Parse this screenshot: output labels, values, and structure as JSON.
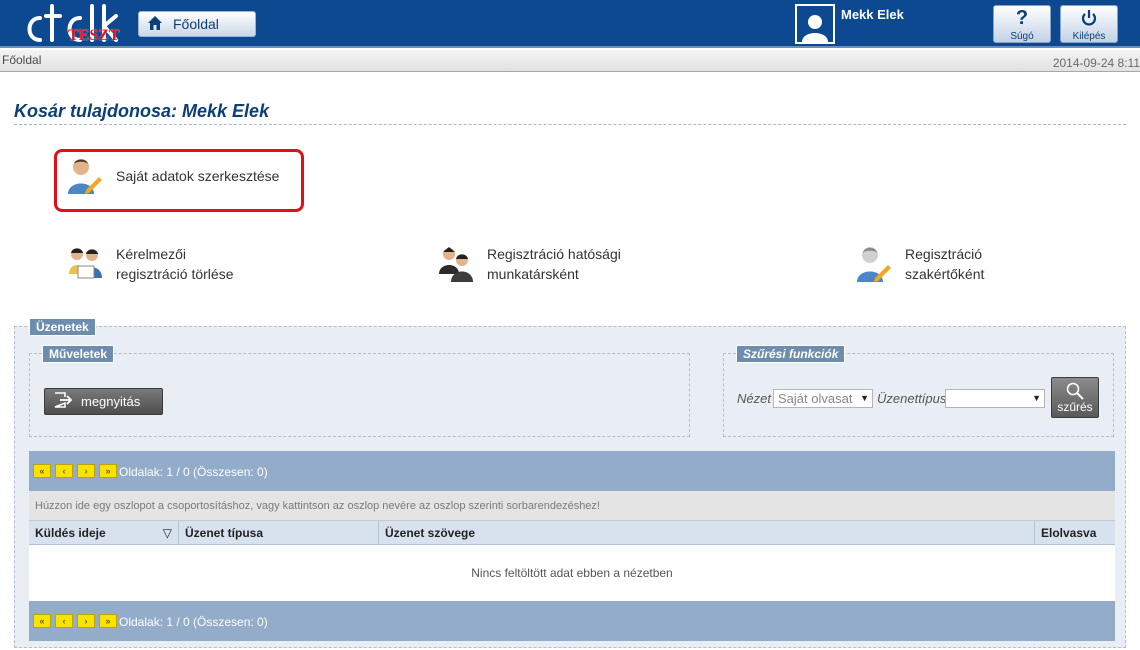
{
  "header": {
    "logo_badge": "TESZT",
    "home_label": "Főoldal",
    "user_name": "Mekk Elek",
    "help_label": "Súgó",
    "logout_label": "Kilépés"
  },
  "breadcrumb": {
    "path": "Főoldal",
    "timestamp": "2014-09-24 8:11"
  },
  "page": {
    "title": "Kosár tulajdonosa: Mekk Elek"
  },
  "actions": {
    "edit_own": "Saját adatok szerkesztése",
    "delete_reg_line1": "Kérelmezői",
    "delete_reg_line2": "regisztráció törlése",
    "reg_official_line1": "Regisztráció hatósági",
    "reg_official_line2": "munkatársként",
    "reg_expert_line1": "Regisztráció",
    "reg_expert_line2": "szakértőként"
  },
  "messages": {
    "legend": "Üzenetek",
    "operations_legend": "Műveletek",
    "open_label": "megnyitás",
    "filter_legend": "Szűrési funkciók",
    "view_label": "Nézet",
    "view_value": "Saját olvasat",
    "type_label": "Üzenettípus",
    "type_value": "",
    "search_label": "szűrés"
  },
  "grid": {
    "pager_info": "Oldalak: 1 / 0 (Összesen: 0)",
    "group_hint": "Húzzon ide egy oszlopot a csoportosításhoz, vagy kattintson az oszlop nevére az oszlop szerinti sorbarendezéshez!",
    "columns": [
      "Küldés ideje",
      "Üzenet típusa",
      "Üzenet szövege",
      "Elolvasva"
    ],
    "sort_indicator": "▽",
    "empty_text": "Nincs feltöltött adat ebben a nézetben"
  },
  "colors": {
    "header_bg": "#0c4990",
    "title": "#0c3e78",
    "highlight": "#e0101a",
    "pager_bg": "#92acc9"
  }
}
